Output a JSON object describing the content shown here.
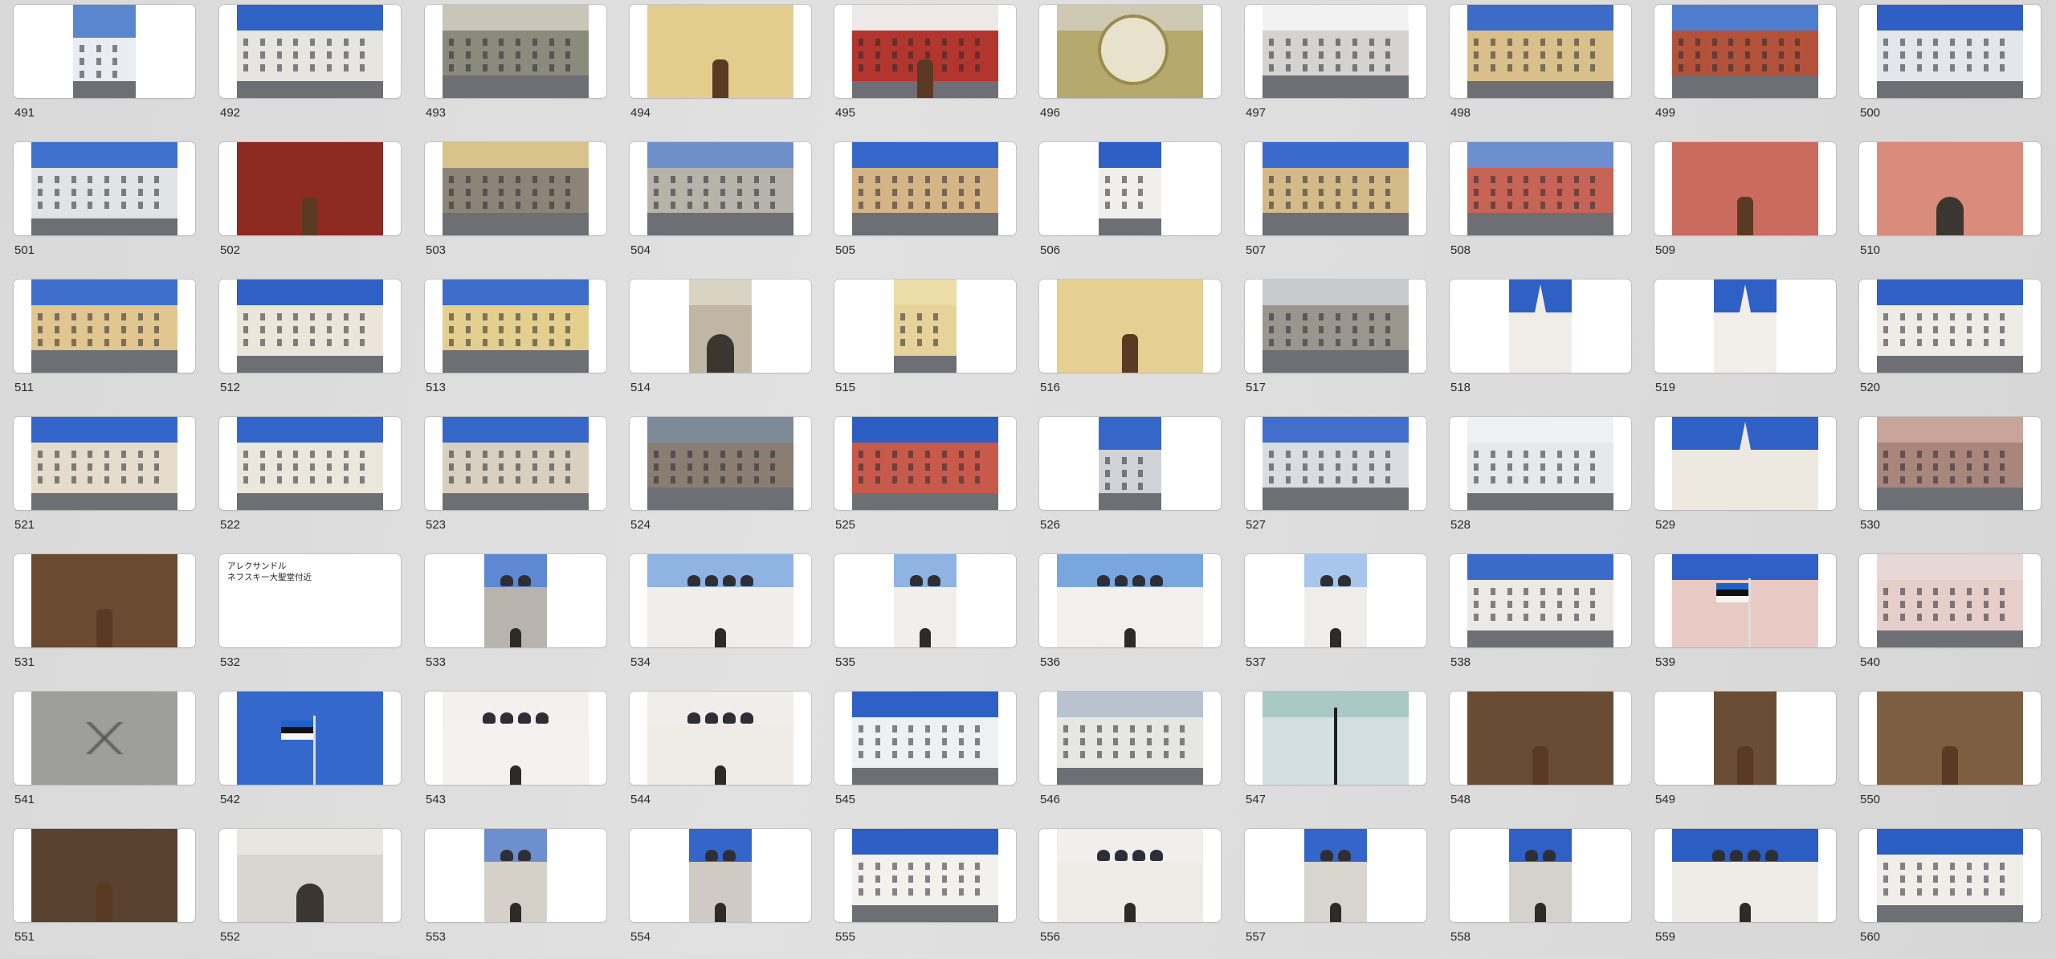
{
  "window": {
    "title": ""
  },
  "text_note": {
    "index": 41,
    "lines": [
      "アレクサンドル",
      "ネフスキー大聖堂付近"
    ]
  },
  "photos": [
    {
      "label": "491",
      "kind": "tall",
      "sky": "#5a86cf",
      "bldg": "#e9ecf2",
      "style": "tower"
    },
    {
      "label": "492",
      "kind": "wide",
      "sky": "#2f63c6",
      "bldg": "#e7e5e0",
      "style": "facade"
    },
    {
      "label": "493",
      "kind": "wide",
      "sky": "#c9c5b8",
      "bldg": "#8a8a7d",
      "style": "street"
    },
    {
      "label": "494",
      "kind": "wide",
      "sky": "#e3cf8f",
      "bldg": "#e2cd8e",
      "style": "door"
    },
    {
      "label": "495",
      "kind": "wide",
      "sky": "#ece9e6",
      "bldg": "#b3362e",
      "style": "shop"
    },
    {
      "label": "496",
      "kind": "wide",
      "sky": "#cfc9b3",
      "bldg": "#b7a96e",
      "style": "clock"
    },
    {
      "label": "497",
      "kind": "wide",
      "sky": "#f2f2f2",
      "bldg": "#d6d2cf",
      "style": "street"
    },
    {
      "label": "498",
      "kind": "wide",
      "sky": "#3d6bc8",
      "bldg": "#d9c08a",
      "style": "facade"
    },
    {
      "label": "499",
      "kind": "wide",
      "sky": "#4e7dd0",
      "bldg": "#b2523a",
      "style": "street"
    },
    {
      "label": "500",
      "kind": "wide",
      "sky": "#2f5fc4",
      "bldg": "#e3e6ea",
      "style": "facade"
    },
    {
      "label": "501",
      "kind": "wide",
      "sky": "#3f72cc",
      "bldg": "#e1e3e6",
      "style": "facade"
    },
    {
      "label": "502",
      "kind": "wide",
      "sky": "#efefef",
      "bldg": "#8d2a22",
      "style": "door"
    },
    {
      "label": "503",
      "kind": "wide",
      "sky": "#d8c48a",
      "bldg": "#8c8577",
      "style": "street"
    },
    {
      "label": "504",
      "kind": "wide",
      "sky": "#6f8fc9",
      "bldg": "#b7b3aa",
      "style": "street"
    },
    {
      "label": "505",
      "kind": "wide",
      "sky": "#3566c9",
      "bldg": "#d5b486",
      "style": "street"
    },
    {
      "label": "506",
      "kind": "tall",
      "sky": "#2d5fc4",
      "bldg": "#f0efec",
      "style": "facade"
    },
    {
      "label": "507",
      "kind": "wide",
      "sky": "#3a6acb",
      "bldg": "#d4b989",
      "style": "street"
    },
    {
      "label": "508",
      "kind": "wide",
      "sky": "#6d8fcf",
      "bldg": "#c76456",
      "style": "street"
    },
    {
      "label": "509",
      "kind": "wide",
      "sky": "#cf6a5c",
      "bldg": "#c96b5e",
      "style": "door"
    },
    {
      "label": "510",
      "kind": "wide",
      "sky": "#d98b7c",
      "bldg": "#d98b7c",
      "style": "arch"
    },
    {
      "label": "511",
      "kind": "wide",
      "sky": "#3e6fcc",
      "bldg": "#e1c690",
      "style": "street"
    },
    {
      "label": "512",
      "kind": "wide",
      "sky": "#2e60c5",
      "bldg": "#ece6da",
      "style": "facade"
    },
    {
      "label": "513",
      "kind": "wide",
      "sky": "#3d6ccb",
      "bldg": "#e4cf8e",
      "style": "street"
    },
    {
      "label": "514",
      "kind": "tall",
      "sky": "#d9d3c4",
      "bldg": "#bfb7a4",
      "style": "arch"
    },
    {
      "label": "515",
      "kind": "tall",
      "sky": "#ecdca6",
      "bldg": "#e7d29a",
      "style": "facade"
    },
    {
      "label": "516",
      "kind": "wide",
      "sky": "#e6cf92",
      "bldg": "#e6cf92",
      "style": "door"
    },
    {
      "label": "517",
      "kind": "wide",
      "sky": "#c7c9cd",
      "bldg": "#9a968d",
      "style": "street"
    },
    {
      "label": "518",
      "kind": "tall",
      "sky": "#2e60c5",
      "bldg": "#f0ede8",
      "style": "church"
    },
    {
      "label": "519",
      "kind": "tall",
      "sky": "#2e60c5",
      "bldg": "#f2efea",
      "style": "church"
    },
    {
      "label": "520",
      "kind": "wide",
      "sky": "#2f61c6",
      "bldg": "#efece6",
      "style": "facade"
    },
    {
      "label": "521",
      "kind": "wide",
      "sky": "#3465c8",
      "bldg": "#e5dccb",
      "style": "facade"
    },
    {
      "label": "522",
      "kind": "wide",
      "sky": "#3466c9",
      "bldg": "#ece7dc",
      "style": "facade"
    },
    {
      "label": "523",
      "kind": "wide",
      "sky": "#3667c9",
      "bldg": "#d9d0bf",
      "style": "facade"
    },
    {
      "label": "524",
      "kind": "wide",
      "sky": "#7f8a99",
      "bldg": "#8a7e72",
      "style": "street"
    },
    {
      "label": "525",
      "kind": "wide",
      "sky": "#2c5ec4",
      "bldg": "#c75a4a",
      "style": "facade"
    },
    {
      "label": "526",
      "kind": "tall",
      "sky": "#3666c8",
      "bldg": "#cfd3d8",
      "style": "tower"
    },
    {
      "label": "527",
      "kind": "wide",
      "sky": "#416fcb",
      "bldg": "#d9dde2",
      "style": "street"
    },
    {
      "label": "528",
      "kind": "wide",
      "sky": "#eef0f2",
      "bldg": "#e7e8ea",
      "style": "facade"
    },
    {
      "label": "529",
      "kind": "wide",
      "sky": "#2f61c6",
      "bldg": "#ede9e1",
      "style": "church"
    },
    {
      "label": "530",
      "kind": "wide",
      "sky": "#c9a49b",
      "bldg": "#a9867c",
      "style": "street"
    },
    {
      "label": "531",
      "kind": "wide",
      "sky": "#7b5a3e",
      "bldg": "#6b4a32",
      "style": "door"
    },
    {
      "label": "532",
      "kind": "blank"
    },
    {
      "label": "533",
      "kind": "tall",
      "sky": "#5f88d2",
      "bldg": "#b8b4ad",
      "style": "cathedral"
    },
    {
      "label": "534",
      "kind": "wide",
      "sky": "#8fb3e3",
      "bldg": "#f0eeeb",
      "style": "cathedral"
    },
    {
      "label": "535",
      "kind": "tall",
      "sky": "#8fb3e3",
      "bldg": "#f1efec",
      "style": "cathedral"
    },
    {
      "label": "536",
      "kind": "wide",
      "sky": "#7aa6e0",
      "bldg": "#f2f0ed",
      "style": "cathedral"
    },
    {
      "label": "537",
      "kind": "tall",
      "sky": "#a8c6ec",
      "bldg": "#efedea",
      "style": "cathedral"
    },
    {
      "label": "538",
      "kind": "wide",
      "sky": "#3a6bcb",
      "bldg": "#eceae6",
      "style": "facade"
    },
    {
      "label": "539",
      "kind": "wide",
      "sky": "#2e60c5",
      "bldg": "#e9c9c4",
      "style": "flag"
    },
    {
      "label": "540",
      "kind": "wide",
      "sky": "#e7d8d5",
      "bldg": "#e6cfcb",
      "style": "facade"
    },
    {
      "label": "541",
      "kind": "wide",
      "sky": "#a9a9a7",
      "bldg": "#9e9e9c",
      "style": "ground"
    },
    {
      "label": "542",
      "kind": "wide",
      "sky": "#3468cb",
      "bldg": "#3468cb",
      "style": "flagpole"
    },
    {
      "label": "543",
      "kind": "wide",
      "sky": "#f2f1ee",
      "bldg": "#f4f2ee",
      "style": "cathedral"
    },
    {
      "label": "544",
      "kind": "wide",
      "sky": "#f0eeea",
      "bldg": "#efece8",
      "style": "cathedral"
    },
    {
      "label": "545",
      "kind": "wide",
      "sky": "#2e60c5",
      "bldg": "#eef0f2",
      "style": "facade"
    },
    {
      "label": "546",
      "kind": "wide",
      "sky": "#b9c3cf",
      "bldg": "#e6e6e2",
      "style": "facade"
    },
    {
      "label": "547",
      "kind": "wide",
      "sky": "#a9c9c5",
      "bldg": "#d2dfe2",
      "style": "lamp"
    },
    {
      "label": "548",
      "kind": "wide",
      "sky": "#4f8778",
      "bldg": "#6a4c34",
      "style": "door"
    },
    {
      "label": "549",
      "kind": "tall",
      "sky": "#4d8574",
      "bldg": "#6b4d35",
      "style": "door"
    },
    {
      "label": "550",
      "kind": "wide",
      "sky": "#8a6a4a",
      "bldg": "#7d5e40",
      "style": "door"
    },
    {
      "label": "551",
      "kind": "wide",
      "sky": "#f4f4f2",
      "bldg": "#5a4230",
      "style": "door"
    },
    {
      "label": "552",
      "kind": "wide",
      "sky": "#e9e6e1",
      "bldg": "#d9d5cf",
      "style": "arch"
    },
    {
      "label": "553",
      "kind": "tall",
      "sky": "#6d8fcf",
      "bldg": "#d6d1c8",
      "style": "cathedral"
    },
    {
      "label": "554",
      "kind": "tall",
      "sky": "#3466c9",
      "bldg": "#cfcac3",
      "style": "cathedral"
    },
    {
      "label": "555",
      "kind": "wide",
      "sky": "#2d5fc4",
      "bldg": "#f3f1ee",
      "style": "facade"
    },
    {
      "label": "556",
      "kind": "wide",
      "sky": "#f1efec",
      "bldg": "#efece8",
      "style": "cathedral"
    },
    {
      "label": "557",
      "kind": "tall",
      "sky": "#3466c9",
      "bldg": "#d8d4ce",
      "style": "cathedral"
    },
    {
      "label": "558",
      "kind": "tall",
      "sky": "#2e60c5",
      "bldg": "#d5d1cb",
      "style": "cathedral"
    },
    {
      "label": "559",
      "kind": "wide",
      "sky": "#2b5dc3",
      "bldg": "#efece8",
      "style": "cathedral"
    },
    {
      "label": "560",
      "kind": "wide",
      "sky": "#2b5ec5",
      "bldg": "#f1eeea",
      "style": "facade"
    }
  ]
}
